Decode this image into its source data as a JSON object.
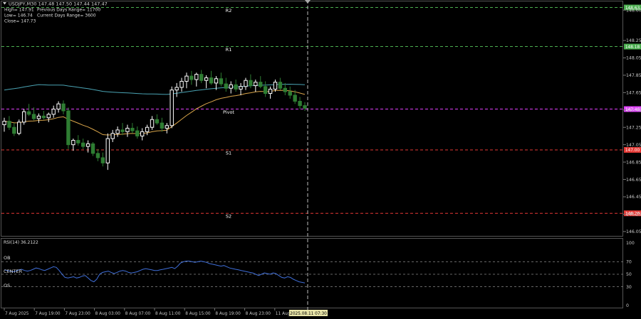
{
  "symbol_line": "USDJPY,M30  147.48 147.50 147.44 147.47",
  "info": {
    "high": "High= 147.91",
    "low": "Low= 146.74",
    "close": "Close= 147.73",
    "prev_range": "Previous Days Range= 11700",
    "curr_range": "Current Days Range= 3600"
  },
  "levels": [
    {
      "name": "R2",
      "price": 148.63,
      "tag": "148.63",
      "color": "#4caf50"
    },
    {
      "name": "R1",
      "price": 148.18,
      "tag": "148.18",
      "color": "#4caf50"
    },
    {
      "name": "Pivot",
      "price": 147.46,
      "tag": "147.46",
      "color": "#e040fb"
    },
    {
      "name": "S1",
      "price": 146.99,
      "tag": "147.00",
      "color": "#e53935"
    },
    {
      "name": "S2",
      "price": 146.26,
      "tag": "146.26",
      "color": "#e53935"
    }
  ],
  "price_ticks": [
    "148.60",
    "148.25",
    "148.05",
    "147.85",
    "147.65",
    "147.45",
    "147.25",
    "147.05",
    "146.85",
    "146.65",
    "146.45",
    "146.25",
    "146.05"
  ],
  "rsi": {
    "label": "RSI(14) 36.2122",
    "ticks": [
      "100",
      "70",
      "50",
      "30",
      "0"
    ],
    "labels": {
      "ob": "OB",
      "center": "CENTER",
      "os": "OS"
    },
    "values": [
      57,
      56,
      55,
      54,
      55,
      57,
      58,
      56,
      55,
      56,
      58,
      60,
      59,
      57,
      56,
      58,
      60,
      62,
      61,
      56,
      50,
      45,
      44,
      45,
      46,
      44,
      45,
      47,
      48,
      44,
      40,
      38,
      42,
      50,
      53,
      54,
      55,
      53,
      51,
      53,
      55,
      56,
      55,
      53,
      52,
      53,
      54,
      56,
      58,
      59,
      58,
      57,
      56,
      56,
      57,
      58,
      59,
      60,
      61,
      59,
      63,
      68,
      70,
      71,
      71,
      70,
      69,
      70,
      71,
      70,
      69,
      67,
      66,
      65,
      64,
      63,
      64,
      62,
      60,
      59,
      58,
      57,
      56,
      55,
      54,
      53,
      52,
      50,
      48,
      50,
      52,
      51,
      50,
      52,
      51,
      48,
      45,
      44,
      46,
      45,
      42,
      40,
      38,
      37,
      36
    ]
  },
  "time_labels": [
    "7 Aug 2025",
    "7 Aug 19:00",
    "7 Aug 23:00",
    "8 Aug 03:00",
    "8 Aug 07:00",
    "8 Aug 11:00",
    "8 Aug 15:00",
    "8 Aug 19:00",
    "8 Aug 23:00",
    "11 Aug"
  ],
  "cursor_time": "2025.08.11 07:30",
  "colors": {
    "background": "#000000",
    "bull": "#ffffff",
    "bear": "#2e7d32",
    "ma_slow": "#4aa3b3",
    "ma_fast": "#d9a54a",
    "rsi_line": "#3f6ed8",
    "text": "#c8c8c8"
  },
  "candles": [
    [
      147.28,
      147.36,
      147.2,
      147.32
    ],
    [
      147.32,
      147.38,
      147.22,
      147.25
    ],
    [
      147.25,
      147.3,
      147.15,
      147.18
    ],
    [
      147.18,
      147.34,
      147.16,
      147.31
    ],
    [
      147.31,
      147.46,
      147.28,
      147.43
    ],
    [
      147.43,
      147.52,
      147.38,
      147.4
    ],
    [
      147.4,
      147.48,
      147.33,
      147.35
    ],
    [
      147.35,
      147.41,
      147.3,
      147.38
    ],
    [
      147.38,
      147.44,
      147.34,
      147.36
    ],
    [
      147.36,
      147.42,
      147.31,
      147.4
    ],
    [
      147.4,
      147.5,
      147.36,
      147.46
    ],
    [
      147.46,
      147.55,
      147.42,
      147.52
    ],
    [
      147.52,
      147.56,
      147.4,
      147.44
    ],
    [
      147.44,
      147.48,
      147.0,
      147.05
    ],
    [
      147.05,
      147.12,
      146.98,
      147.1
    ],
    [
      147.1,
      147.16,
      147.04,
      147.07
    ],
    [
      147.07,
      147.12,
      147.0,
      147.03
    ],
    [
      147.03,
      147.1,
      146.96,
      147.06
    ],
    [
      147.06,
      147.08,
      146.92,
      146.95
    ],
    [
      146.95,
      147.0,
      146.86,
      146.9
    ],
    [
      146.9,
      146.96,
      146.8,
      146.84
    ],
    [
      146.84,
      147.18,
      146.76,
      147.12
    ],
    [
      147.12,
      147.22,
      147.08,
      147.18
    ],
    [
      147.18,
      147.26,
      147.14,
      147.22
    ],
    [
      147.22,
      147.3,
      147.16,
      147.2
    ],
    [
      147.2,
      147.28,
      147.14,
      147.24
    ],
    [
      147.24,
      147.3,
      147.18,
      147.21
    ],
    [
      147.21,
      147.26,
      147.12,
      147.15
    ],
    [
      147.15,
      147.24,
      147.1,
      147.2
    ],
    [
      147.2,
      147.28,
      147.16,
      147.25
    ],
    [
      147.25,
      147.38,
      147.22,
      147.34
    ],
    [
      147.34,
      147.4,
      147.28,
      147.3
    ],
    [
      147.3,
      147.36,
      147.2,
      147.24
    ],
    [
      147.24,
      147.3,
      147.18,
      147.27
    ],
    [
      147.27,
      147.72,
      147.24,
      147.68
    ],
    [
      147.68,
      147.76,
      147.6,
      147.71
    ],
    [
      147.71,
      147.82,
      147.66,
      147.78
    ],
    [
      147.78,
      147.88,
      147.7,
      147.84
    ],
    [
      147.84,
      147.9,
      147.74,
      147.8
    ],
    [
      147.8,
      147.88,
      147.72,
      147.86
    ],
    [
      147.86,
      147.91,
      147.76,
      147.79
    ],
    [
      147.79,
      147.85,
      147.7,
      147.82
    ],
    [
      147.82,
      147.9,
      147.74,
      147.76
    ],
    [
      147.76,
      147.84,
      147.68,
      147.81
    ],
    [
      147.81,
      147.88,
      147.72,
      147.75
    ],
    [
      147.75,
      147.82,
      147.66,
      147.7
    ],
    [
      147.7,
      147.78,
      147.64,
      147.74
    ],
    [
      147.74,
      147.8,
      147.66,
      147.69
    ],
    [
      147.69,
      147.76,
      147.62,
      147.72
    ],
    [
      147.72,
      147.82,
      147.68,
      147.79
    ],
    [
      147.79,
      147.86,
      147.7,
      147.73
    ],
    [
      147.73,
      147.8,
      147.66,
      147.77
    ],
    [
      147.77,
      147.84,
      147.7,
      147.72
    ],
    [
      147.72,
      147.78,
      147.6,
      147.64
    ],
    [
      147.64,
      147.72,
      147.58,
      147.69
    ],
    [
      147.69,
      147.8,
      147.66,
      147.77
    ],
    [
      147.77,
      147.82,
      147.68,
      147.7
    ],
    [
      147.7,
      147.76,
      147.62,
      147.66
    ],
    [
      147.66,
      147.72,
      147.58,
      147.62
    ],
    [
      147.62,
      147.68,
      147.52,
      147.55
    ],
    [
      147.55,
      147.6,
      147.46,
      147.5
    ],
    [
      147.5,
      147.54,
      147.44,
      147.47
    ]
  ]
}
